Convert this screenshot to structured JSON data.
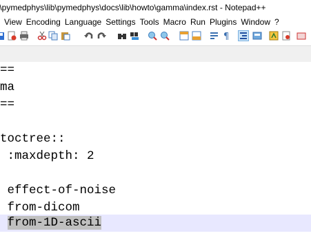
{
  "window": {
    "title": "f\\pymedphys\\lib\\pymedphys\\docs\\lib\\howto\\gamma\\index.rst - Notepad++"
  },
  "menu": [
    "View",
    "Encoding",
    "Language",
    "Settings",
    "Tools",
    "Macro",
    "Run",
    "Plugins",
    "Window",
    "?"
  ],
  "toolbar_icons": [
    "save-all-icon",
    "close-icon",
    "print-icon",
    "cut-icon",
    "copy-icon",
    "paste-icon",
    "undo-icon",
    "redo-icon",
    "find-icon",
    "replace-icon",
    "zoom-in-icon",
    "zoom-out-icon",
    "sync-vertical-icon",
    "sync-horizontal-icon",
    "word-wrap-icon",
    "show-all-chars-icon",
    "indent-guide-icon",
    "doc-map-icon",
    "function-list-icon",
    "folder-workspace-icon",
    "macro-record-icon"
  ],
  "editor": {
    "lines": [
      "==",
      "ma",
      "==",
      "",
      "toctree::",
      " :maxdepth: 2",
      "",
      " effect-of-noise",
      " from-dicom",
      " from-1D-ascii"
    ],
    "current_line_index": 9,
    "selected_text": "from-1D-ascii"
  },
  "colors": {
    "current_line_bg": "#e8e8ff",
    "selection_bg": "#c0c0c0"
  }
}
